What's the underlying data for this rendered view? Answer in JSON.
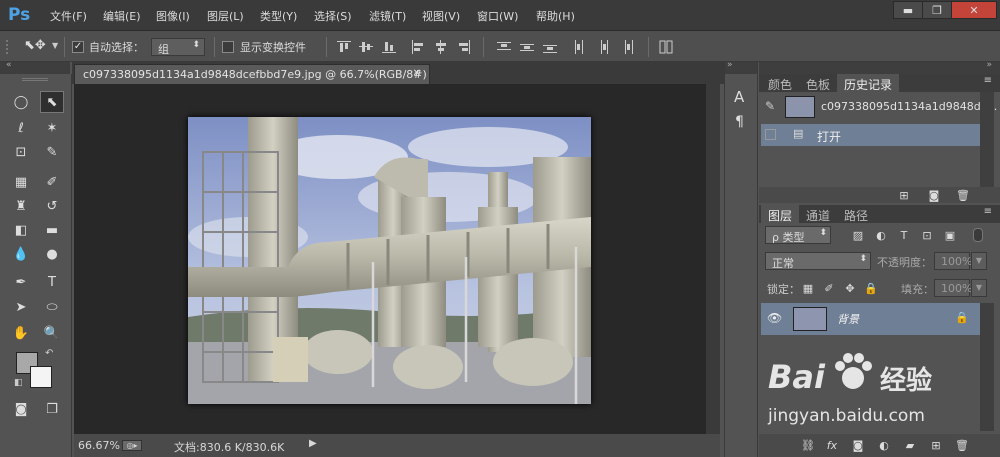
{
  "app": {
    "logo": "Ps"
  },
  "menu": [
    "文件(F)",
    "编辑(E)",
    "图像(I)",
    "图层(L)",
    "类型(Y)",
    "选择(S)",
    "滤镜(T)",
    "视图(V)",
    "窗口(W)",
    "帮助(H)"
  ],
  "window_controls": {
    "minimize": "▬",
    "restore": "❐",
    "close": "✕"
  },
  "options": {
    "auto_select_label": "自动选择：",
    "auto_select_checked": "✓",
    "group_value": "组",
    "show_transform_label": "显示变换控件"
  },
  "document": {
    "tab_title": "c097338095d1134a1d9848dcefbbd7e9.jpg @ 66.7%(RGB/8#)",
    "tab_close": "✕",
    "zoom": "66.67%",
    "doc_size": "文档:830.6 K/830.6K"
  },
  "history_panel": {
    "tabs": [
      "颜色",
      "色板",
      "历史记录"
    ],
    "snapshot_name": "c097338095d1134a1d9848dc...",
    "states": [
      "打开"
    ]
  },
  "layers_panel": {
    "tabs": [
      "图层",
      "通道",
      "路径"
    ],
    "filter_kind": "类型",
    "blend_mode": "正常",
    "opacity_label": "不透明度：",
    "opacity_value": "100%",
    "lock_label": "锁定：",
    "fill_label": "填充：",
    "fill_value": "100%",
    "layers": [
      {
        "name": "背景",
        "visible": true,
        "locked": true
      }
    ]
  },
  "watermark": {
    "brand": "Bai",
    "brand2": "经验",
    "url": "jingyan.baidu.com"
  }
}
